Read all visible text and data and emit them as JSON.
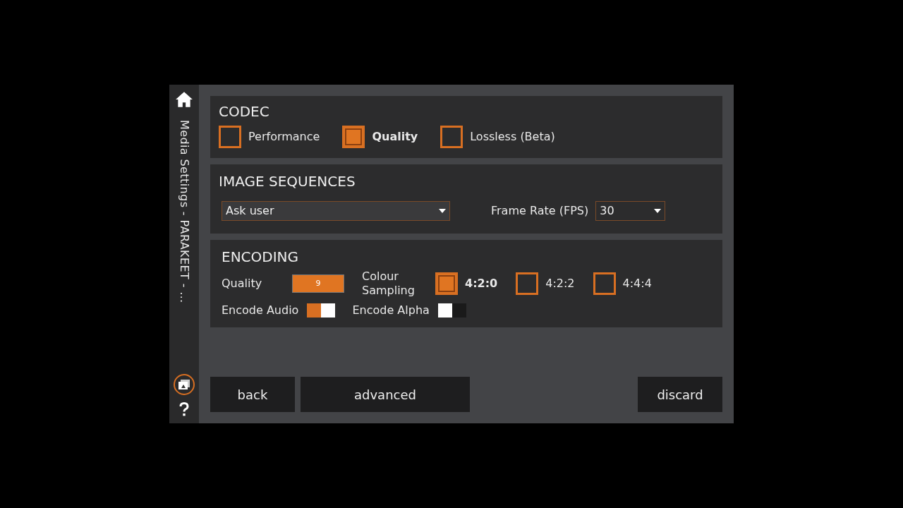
{
  "sidebar": {
    "title": "Media Settings - PARAKEET - …"
  },
  "codec": {
    "title": "CODEC",
    "options": [
      {
        "label": "Performance",
        "selected": false
      },
      {
        "label": "Quality",
        "selected": true
      },
      {
        "label": "Lossless (Beta)",
        "selected": false
      }
    ]
  },
  "image_sequences": {
    "title": "IMAGE SEQUENCES",
    "mode": {
      "value": "Ask user"
    },
    "frame_rate": {
      "label": "Frame Rate (FPS)",
      "value": "30"
    }
  },
  "encoding": {
    "title": "ENCODING",
    "quality": {
      "label": "Quality",
      "value": "9"
    },
    "colour_sampling": {
      "label": "Colour Sampling",
      "options": [
        {
          "label": "4:2:0",
          "selected": true
        },
        {
          "label": "4:2:2",
          "selected": false
        },
        {
          "label": "4:4:4",
          "selected": false
        }
      ]
    },
    "toggles": [
      {
        "label": "Encode Audio",
        "on": true
      },
      {
        "label": "Encode Alpha",
        "on": false
      }
    ]
  },
  "buttons": [
    {
      "label": "back",
      "kind": "left"
    },
    {
      "label": "advanced",
      "kind": "left"
    },
    {
      "label": "discard",
      "kind": "right"
    }
  ]
}
